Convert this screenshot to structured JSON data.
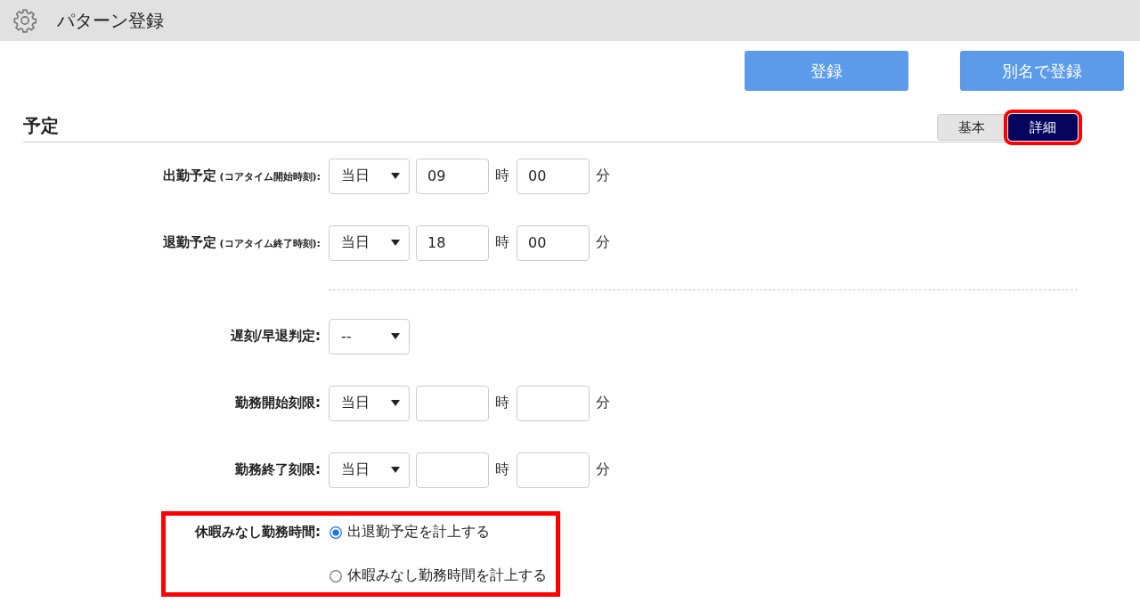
{
  "header": {
    "title": "パターン登録"
  },
  "actions": [
    {
      "label": "登録"
    },
    {
      "label": "別名で登録"
    }
  ],
  "section": {
    "title": "予定",
    "tabs": [
      {
        "label": "基本",
        "selected": false,
        "highlighted": false
      },
      {
        "label": "詳細",
        "selected": true,
        "highlighted": true
      }
    ]
  },
  "rows": [
    {
      "kind": "time",
      "label": "出勤予定",
      "note": "(コアタイム開始時刻):",
      "day": "当日",
      "hour": "09",
      "hour_unit": "時",
      "minute": "00",
      "minute_unit": "分"
    },
    {
      "kind": "time",
      "label": "退勤予定",
      "note": "(コアタイム終了時刻):",
      "day": "当日",
      "hour": "18",
      "hour_unit": "時",
      "minute": "00",
      "minute_unit": "分"
    },
    {
      "kind": "divider"
    },
    {
      "kind": "select",
      "label": "遅刻/早退判定:",
      "value": "--"
    },
    {
      "kind": "time",
      "label": "勤務開始刻限:",
      "day": "当日",
      "hour_unit": "時",
      "minute_unit": "分"
    },
    {
      "kind": "time",
      "label": "勤務終了刻限:",
      "day": "当日",
      "hour_unit": "時",
      "minute_unit": "分"
    },
    {
      "kind": "radio",
      "label": "休暇みなし勤務時間:",
      "highlighted": true,
      "options": [
        {
          "label": "出退勤予定を計上する",
          "selected": true
        },
        {
          "label": "休暇みなし勤務時間を計上する",
          "selected": false
        }
      ]
    }
  ]
}
